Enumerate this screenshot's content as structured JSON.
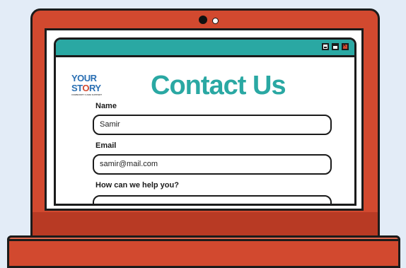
{
  "logo": {
    "line1": "YOUR",
    "line2_a": "ST",
    "line2_b": "O",
    "line2_c": "RY",
    "tagline": "COMMUNITY CARE SUPPORT"
  },
  "page_title": "Contact Us",
  "form": {
    "name_label": "Name",
    "name_value": "Samir",
    "email_label": "Email",
    "email_value": "samir@mail.com",
    "help_label": "How can we help you?",
    "help_value": ""
  },
  "colors": {
    "laptop": "#d2492f",
    "title_teal": "#2aa8a3",
    "logo_blue": "#2a6fb3",
    "background": "#e3ecf7"
  },
  "icons": [
    "minimize-icon",
    "maximize-icon",
    "close-icon",
    "webcam-icon"
  ]
}
